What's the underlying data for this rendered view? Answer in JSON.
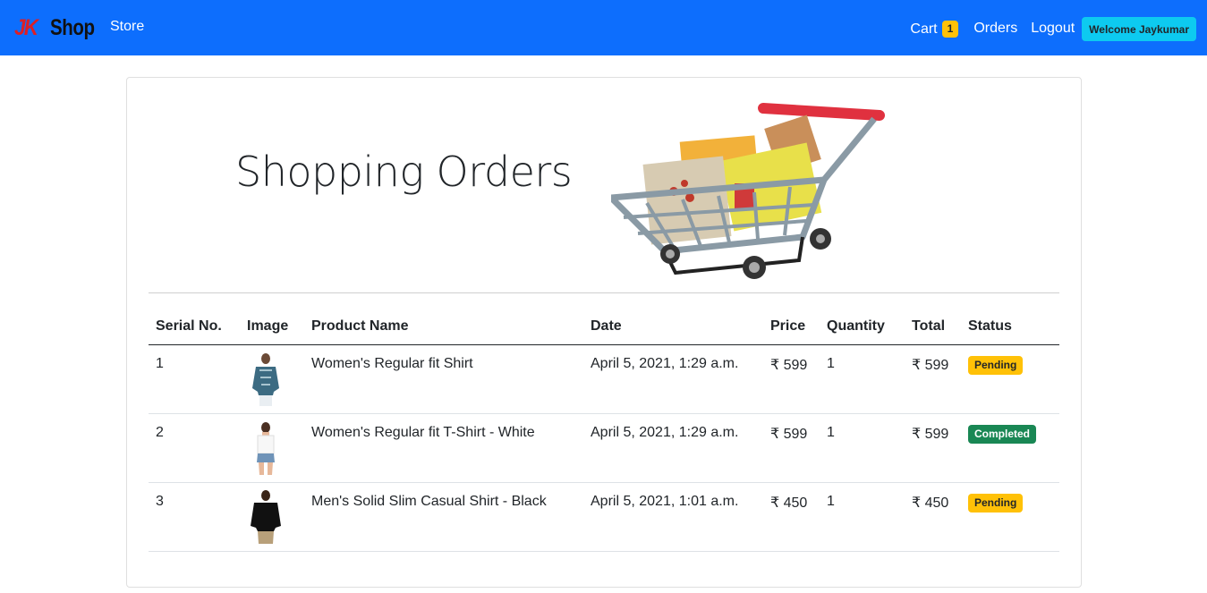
{
  "navbar": {
    "brand_jk": "JK",
    "brand_shop": "Shop",
    "store": "Store",
    "cart": "Cart",
    "cart_count": "1",
    "orders": "Orders",
    "logout": "Logout",
    "welcome": "Welcome Jaykumar"
  },
  "page": {
    "title": "Shopping Orders"
  },
  "table": {
    "headers": [
      "Serial No.",
      "Image",
      "Product Name",
      "Date",
      "Price",
      "Quantity",
      "Total",
      "Status"
    ],
    "rows": [
      {
        "serial": "1",
        "image": "women-shirt-thumbnail",
        "name": "Women's Regular fit Shirt",
        "date": "April 5, 2021, 1:29 a.m.",
        "price": "₹ 599",
        "quantity": "1",
        "total": "₹ 599",
        "status": "Pending"
      },
      {
        "serial": "2",
        "image": "women-tshirt-thumbnail",
        "name": "Women's Regular fit T-Shirt - White",
        "date": "April 5, 2021, 1:29 a.m.",
        "price": "₹ 599",
        "quantity": "1",
        "total": "₹ 599",
        "status": "Completed"
      },
      {
        "serial": "3",
        "image": "men-shirt-thumbnail",
        "name": "Men's Solid Slim Casual Shirt - Black",
        "date": "April 5, 2021, 1:01 a.m.",
        "price": "₹ 450",
        "quantity": "1",
        "total": "₹ 450",
        "status": "Pending"
      }
    ]
  },
  "colors": {
    "navbar": "#0d6efd",
    "pending": "#ffc107",
    "completed": "#198754",
    "welcome": "#0dcaf0"
  }
}
